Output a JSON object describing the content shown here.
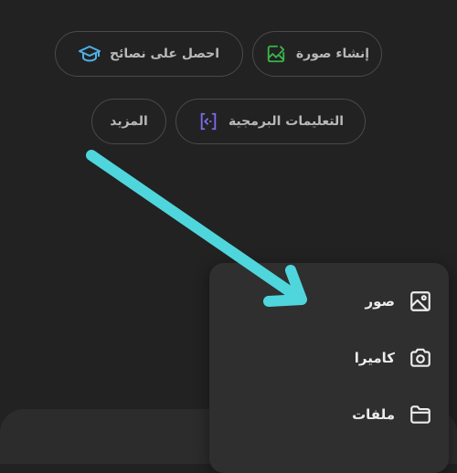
{
  "suggestions": {
    "create_image": {
      "label": "إنشاء صورة",
      "icon": "image-edit-icon",
      "icon_color": "#3bb54a"
    },
    "get_advice": {
      "label": "احصل على نصائح",
      "icon": "graduation-cap-icon",
      "icon_color": "#4fb0e8"
    },
    "code": {
      "label": "التعليمات البرمجية",
      "icon": "code-brackets-icon",
      "icon_color": "#7b6cf0"
    },
    "more": {
      "label": "المزيد"
    }
  },
  "attach_menu": {
    "items": [
      {
        "label": "صور",
        "icon": "image-icon"
      },
      {
        "label": "كاميرا",
        "icon": "camera-icon"
      },
      {
        "label": "ملفات",
        "icon": "folder-icon"
      }
    ]
  },
  "annotation": {
    "arrow_color": "#4fd6dc"
  },
  "colors": {
    "background": "#222222",
    "chip_border": "#4a4a4a",
    "menu_bg": "#2f2f2f"
  }
}
